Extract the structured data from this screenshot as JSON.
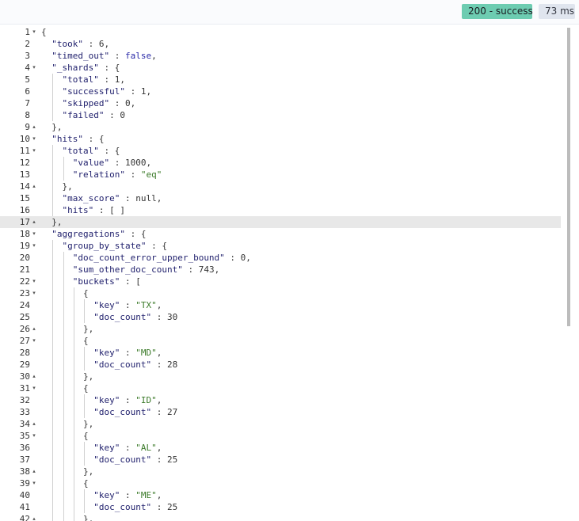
{
  "status": {
    "label": "200 - success",
    "color": "#6dccb1"
  },
  "timing": {
    "label": "73 ms"
  },
  "editor": {
    "active_line": 17,
    "lines": [
      {
        "n": "1",
        "f": "▾",
        "t": "{"
      },
      {
        "n": "2",
        "f": "",
        "t": "  \"took\" : 6,"
      },
      {
        "n": "3",
        "f": "",
        "t": "  \"timed_out\" : false,"
      },
      {
        "n": "4",
        "f": "▾",
        "t": "  \"_shards\" : {"
      },
      {
        "n": "5",
        "f": "",
        "t": "    \"total\" : 1,"
      },
      {
        "n": "6",
        "f": "",
        "t": "    \"successful\" : 1,"
      },
      {
        "n": "7",
        "f": "",
        "t": "    \"skipped\" : 0,"
      },
      {
        "n": "8",
        "f": "",
        "t": "    \"failed\" : 0"
      },
      {
        "n": "9",
        "f": "▴",
        "t": "  },"
      },
      {
        "n": "10",
        "f": "▾",
        "t": "  \"hits\" : {"
      },
      {
        "n": "11",
        "f": "▾",
        "t": "    \"total\" : {"
      },
      {
        "n": "12",
        "f": "",
        "t": "      \"value\" : 1000,"
      },
      {
        "n": "13",
        "f": "",
        "t": "      \"relation\" : \"eq\""
      },
      {
        "n": "14",
        "f": "▴",
        "t": "    },"
      },
      {
        "n": "15",
        "f": "",
        "t": "    \"max_score\" : null,"
      },
      {
        "n": "16",
        "f": "",
        "t": "    \"hits\" : [ ]"
      },
      {
        "n": "17",
        "f": "▴",
        "t": "  },"
      },
      {
        "n": "18",
        "f": "▾",
        "t": "  \"aggregations\" : {"
      },
      {
        "n": "19",
        "f": "▾",
        "t": "    \"group_by_state\" : {"
      },
      {
        "n": "20",
        "f": "",
        "t": "      \"doc_count_error_upper_bound\" : 0,"
      },
      {
        "n": "21",
        "f": "",
        "t": "      \"sum_other_doc_count\" : 743,"
      },
      {
        "n": "22",
        "f": "▾",
        "t": "      \"buckets\" : ["
      },
      {
        "n": "23",
        "f": "▾",
        "t": "        {"
      },
      {
        "n": "24",
        "f": "",
        "t": "          \"key\" : \"TX\","
      },
      {
        "n": "25",
        "f": "",
        "t": "          \"doc_count\" : 30"
      },
      {
        "n": "26",
        "f": "▴",
        "t": "        },"
      },
      {
        "n": "27",
        "f": "▾",
        "t": "        {"
      },
      {
        "n": "28",
        "f": "",
        "t": "          \"key\" : \"MD\","
      },
      {
        "n": "29",
        "f": "",
        "t": "          \"doc_count\" : 28"
      },
      {
        "n": "30",
        "f": "▴",
        "t": "        },"
      },
      {
        "n": "31",
        "f": "▾",
        "t": "        {"
      },
      {
        "n": "32",
        "f": "",
        "t": "          \"key\" : \"ID\","
      },
      {
        "n": "33",
        "f": "",
        "t": "          \"doc_count\" : 27"
      },
      {
        "n": "34",
        "f": "▴",
        "t": "        },"
      },
      {
        "n": "35",
        "f": "▾",
        "t": "        {"
      },
      {
        "n": "36",
        "f": "",
        "t": "          \"key\" : \"AL\","
      },
      {
        "n": "37",
        "f": "",
        "t": "          \"doc_count\" : 25"
      },
      {
        "n": "38",
        "f": "▴",
        "t": "        },"
      },
      {
        "n": "39",
        "f": "▾",
        "t": "        {"
      },
      {
        "n": "40",
        "f": "",
        "t": "          \"key\" : \"ME\","
      },
      {
        "n": "41",
        "f": "",
        "t": "          \"doc_count\" : 25"
      },
      {
        "n": "42",
        "f": "▴",
        "t": "        },"
      }
    ]
  }
}
